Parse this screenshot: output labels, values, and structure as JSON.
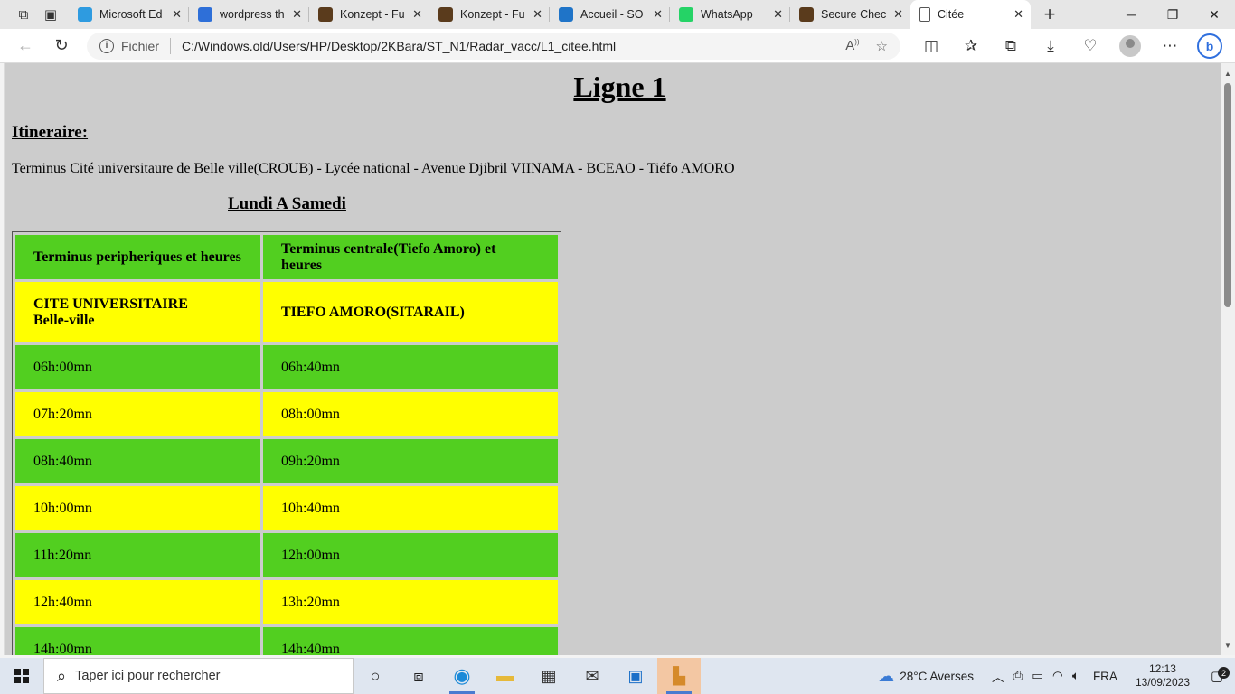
{
  "browser": {
    "tabs": [
      {
        "title": "Microsoft Ed",
        "icon": "edge-icon",
        "color": "#2e9be0"
      },
      {
        "title": "wordpress th",
        "icon": "search-icon",
        "color": "#2e6fd8"
      },
      {
        "title": "Konzept - Fu",
        "icon": "site-icon",
        "color": "#5a3b1c"
      },
      {
        "title": "Konzept - Fu",
        "icon": "site-icon",
        "color": "#5a3b1c"
      },
      {
        "title": "Accueil - SO",
        "icon": "globe-icon",
        "color": "#1f74c8"
      },
      {
        "title": "WhatsApp",
        "icon": "whatsapp-icon",
        "color": "#25d366"
      },
      {
        "title": "Secure Chec",
        "icon": "site-icon",
        "color": "#5a3b1c"
      },
      {
        "title": "Citée",
        "icon": "page-icon",
        "color": "#666666",
        "active": true
      }
    ],
    "address": {
      "protocol_label": "Fichier",
      "url": "C:/Windows.old/Users/HP/Desktop/2KBara/ST_N1/Radar_vacc/L1_citee.html"
    }
  },
  "page": {
    "title": "Ligne 1",
    "itinerary_heading": "Itineraire:",
    "itinerary": "Terminus Cité universitaure de Belle ville(CROUB) - Lycée national - Avenue Djibril VIINAMA - BCEAO - Tiéfo AMORO",
    "days": "Lundi A Samedi",
    "table": {
      "headers": [
        "Terminus peripheriques et heures",
        "Terminus centrale(Tiefo Amoro) et heures"
      ],
      "stations": {
        "left_line1": "CITE UNIVERSITAIRE",
        "left_line2": "Belle-ville",
        "right": "TIEFO AMORO(SITARAIL)"
      },
      "rows": [
        [
          "06h:00mn",
          "06h:40mn"
        ],
        [
          "07h:20mn",
          "08h:00mn"
        ],
        [
          "08h:40mn",
          "09h:20mn"
        ],
        [
          "10h:00mn",
          "10h:40mn"
        ],
        [
          "11h:20mn",
          "12h:00mn"
        ],
        [
          "12h:40mn",
          "13h:20mn"
        ],
        [
          "14h:00mn",
          "14h:40mn"
        ]
      ]
    },
    "colors": {
      "green": "#52cf20",
      "yellow": "#ffff00",
      "background": "#cccccc"
    }
  },
  "taskbar": {
    "search_placeholder": "Taper ici pour rechercher",
    "weather": "28°C  Averses",
    "language": "FRA",
    "time": "12:13",
    "date": "13/09/2023",
    "notifications": "2"
  }
}
